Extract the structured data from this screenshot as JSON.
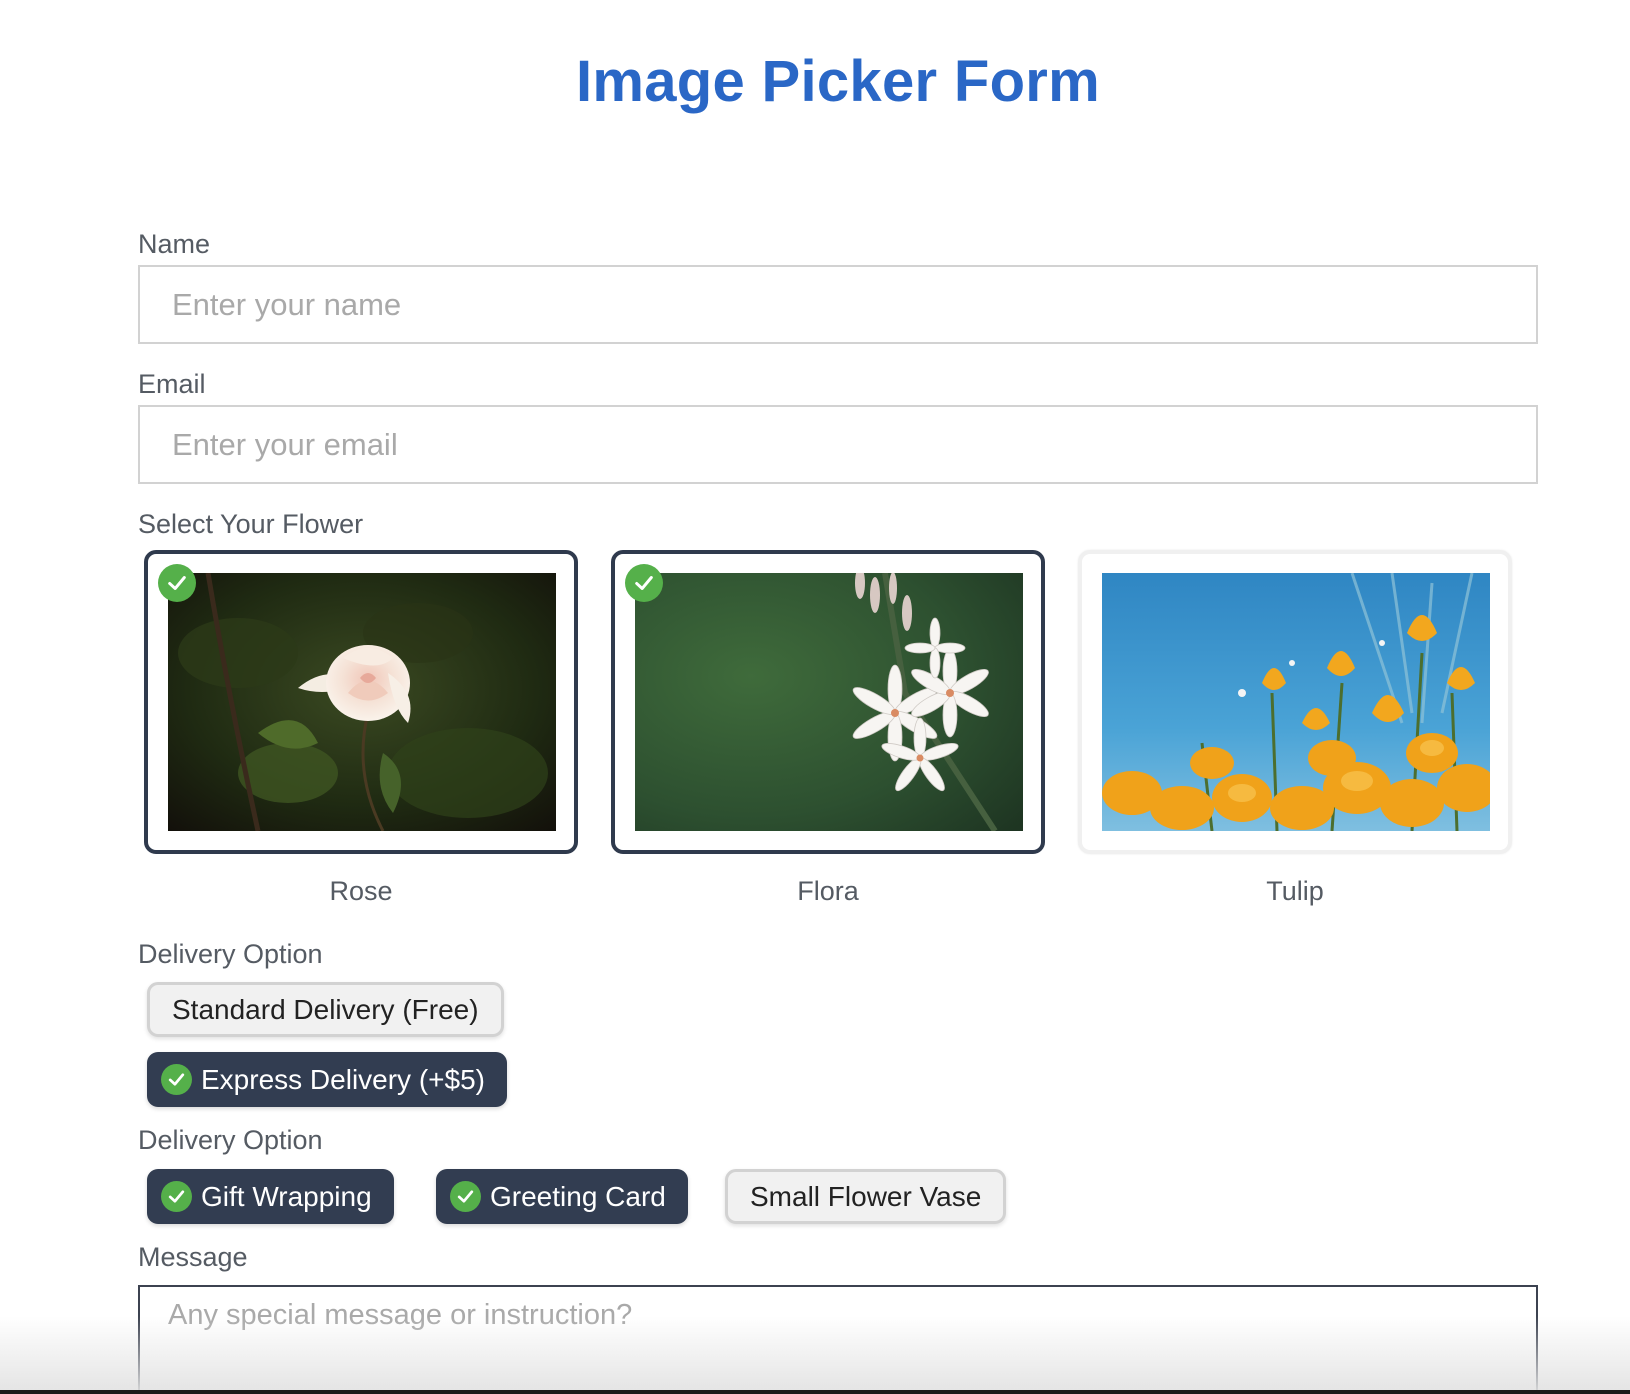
{
  "title": "Image Picker Form",
  "fields": {
    "name_label": "Name",
    "name_placeholder": "Enter your name",
    "email_label": "Email",
    "email_placeholder": "Enter your email",
    "flower_label": "Select Your Flower",
    "message_label": "Message",
    "message_placeholder": "Any special message or instruction?"
  },
  "flowers": [
    {
      "name": "Rose",
      "selected": true
    },
    {
      "name": "Flora",
      "selected": true
    },
    {
      "name": "Tulip",
      "selected": false
    }
  ],
  "delivery": {
    "label": "Delivery Option",
    "options": [
      {
        "label": "Standard Delivery (Free)",
        "selected": false
      },
      {
        "label": "Express Delivery (+$5)",
        "selected": true
      }
    ]
  },
  "extras": {
    "label": "Delivery Option",
    "options": [
      {
        "label": "Gift Wrapping",
        "selected": true
      },
      {
        "label": "Greeting Card",
        "selected": true
      },
      {
        "label": "Small Flower Vase",
        "selected": false
      }
    ]
  },
  "colors": {
    "title": "#2a67c6",
    "selected_bg": "#323d51",
    "check_green": "#55b04a"
  }
}
